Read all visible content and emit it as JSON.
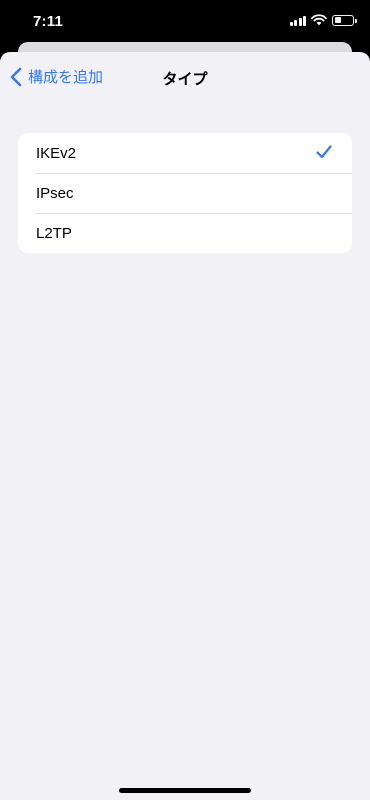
{
  "status_bar": {
    "time": "7:11",
    "icons": [
      "cellular-signal-icon",
      "wifi-icon",
      "battery-icon"
    ],
    "battery_level": 0.35
  },
  "nav": {
    "back_label": "構成を追加",
    "title": "タイプ"
  },
  "types": [
    {
      "label": "IKEv2",
      "selected": true
    },
    {
      "label": "IPsec",
      "selected": false
    },
    {
      "label": "L2TP",
      "selected": false
    }
  ],
  "colors": {
    "accent": "#3478f6",
    "background": "#f2f2f6",
    "card": "#ffffff"
  }
}
